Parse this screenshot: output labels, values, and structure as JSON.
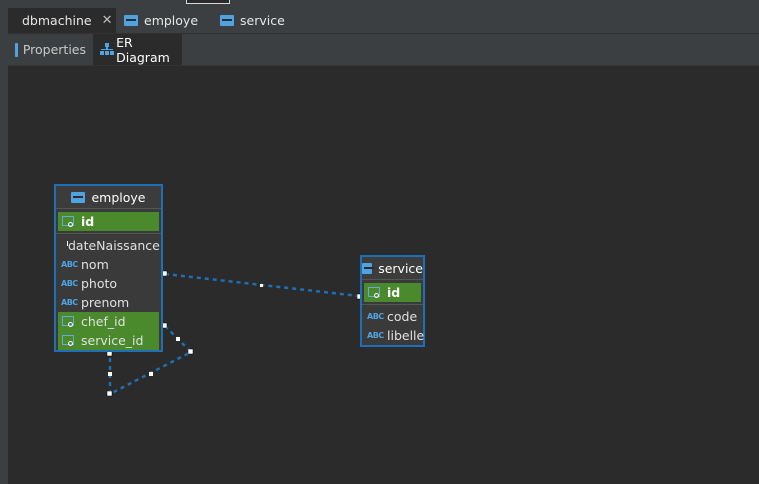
{
  "editor_tabs": [
    {
      "label": "dbmachine",
      "icon": "database-icon",
      "active": true,
      "closable": true
    },
    {
      "label": "employe",
      "icon": "table-icon",
      "active": false
    },
    {
      "label": "service",
      "icon": "table-icon",
      "active": false
    }
  ],
  "sub_tabs": [
    {
      "label": "Properties",
      "icon": "database-icon",
      "active": false
    },
    {
      "label": "ER Diagram",
      "icon": "er-diagram-icon",
      "active": true
    }
  ],
  "entities": {
    "employe": {
      "title": "employe",
      "key_column": "id",
      "columns": [
        {
          "name": "dateNaissance",
          "type_icon": "clock-icon"
        },
        {
          "name": "nom",
          "type_icon": "abc-icon"
        },
        {
          "name": "photo",
          "type_icon": "abc-icon"
        },
        {
          "name": "prenom",
          "type_icon": "abc-icon"
        },
        {
          "name": "chef_id",
          "type_icon": "foreign-key-icon"
        },
        {
          "name": "service_id",
          "type_icon": "foreign-key-icon"
        }
      ]
    },
    "service": {
      "title": "service",
      "key_column": "id",
      "columns": [
        {
          "name": "code",
          "type_icon": "abc-icon"
        },
        {
          "name": "libelle",
          "type_icon": "abc-icon"
        }
      ]
    }
  },
  "icon_text": {
    "abc": "ABC"
  },
  "colors": {
    "accent": "#1e6fb4",
    "key_highlight": "#4a8a2c",
    "link": "#1e6fb4",
    "background": "#2b2b2b"
  }
}
